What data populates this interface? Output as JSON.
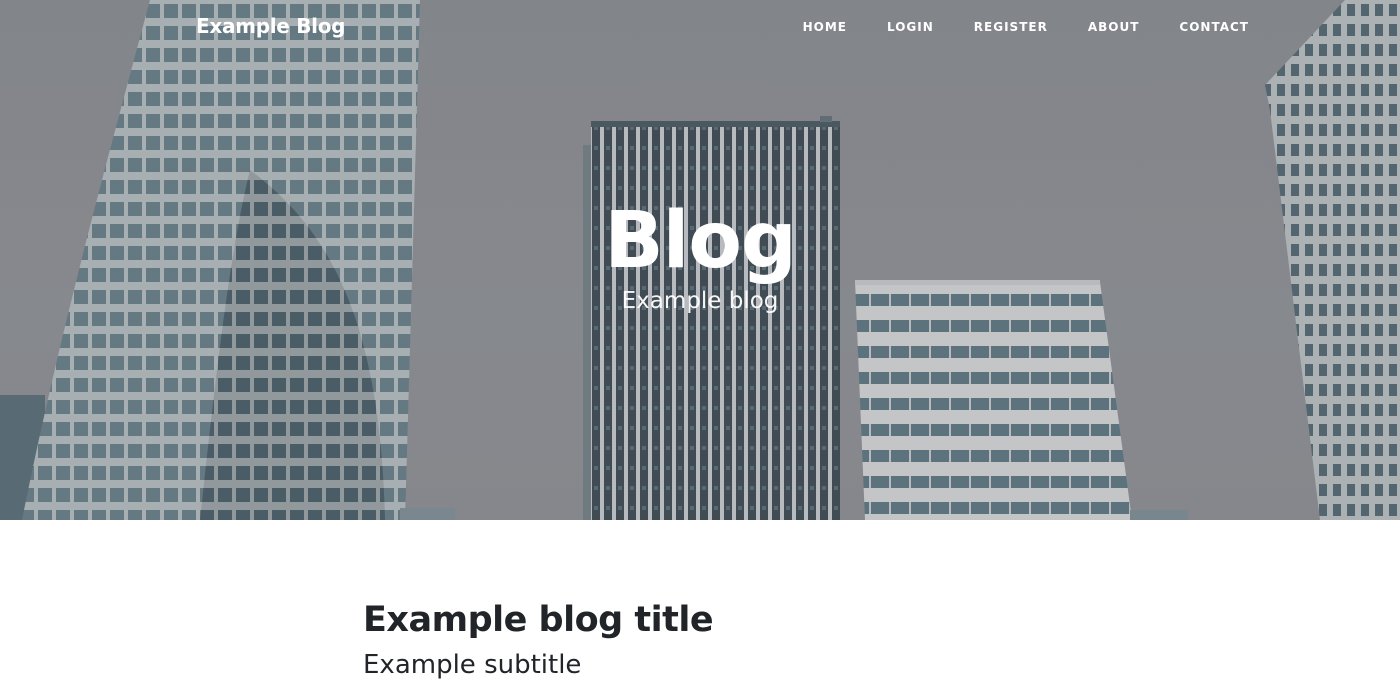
{
  "navbar": {
    "brand": "Example Blog",
    "links": [
      "HOME",
      "LOGIN",
      "REGISTER",
      "ABOUT",
      "CONTACT"
    ]
  },
  "hero": {
    "title": "Blog",
    "subtitle": "Example blog"
  },
  "posts": [
    {
      "title": "Example blog title",
      "subtitle": "Example subtitle"
    }
  ],
  "colors": {
    "sky": "#8a8d92",
    "glass": "#5b7480",
    "text_dark": "#212529",
    "text_light": "#ffffff"
  }
}
